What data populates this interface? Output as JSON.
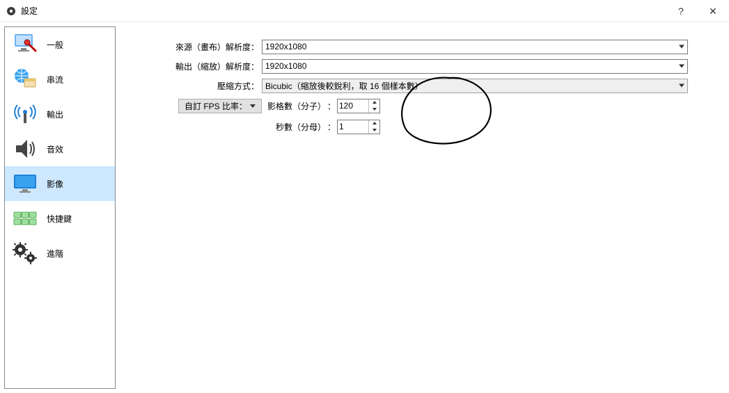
{
  "window": {
    "title": "設定",
    "help_icon": "?",
    "close_icon": "✕"
  },
  "sidebar": {
    "items": [
      {
        "label": "一般",
        "icon": "monitor-wrench"
      },
      {
        "label": "串流",
        "icon": "globe-box"
      },
      {
        "label": "輸出",
        "icon": "broadcast"
      },
      {
        "label": "音效",
        "icon": "speaker"
      },
      {
        "label": "影像",
        "icon": "monitor"
      },
      {
        "label": "快捷鍵",
        "icon": "keyboard"
      },
      {
        "label": "進階",
        "icon": "gears"
      }
    ],
    "selected_index": 4
  },
  "form": {
    "base_label": "來源（畫布）解析度：",
    "base_value": "1920x1080",
    "output_label": "輸出（縮放）解析度：",
    "output_value": "1920x1080",
    "scale_label": "壓縮方式：",
    "scale_value": "Bicubic（縮放後較銳利，取 16 個樣本數）",
    "fps_button_label": "自訂 FPS 比率：",
    "fps_numerator_label": "影格數（分子）",
    "fps_numerator_value": "120",
    "fps_denominator_label": "秒數（分母）",
    "fps_denominator_value": "1",
    "colon": "："
  }
}
